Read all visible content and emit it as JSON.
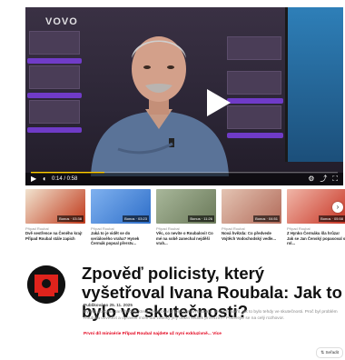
{
  "player": {
    "logo": "VOVO",
    "time": "0:14 / 0:58",
    "progress": 0.24,
    "icons": [
      "play-icon",
      "volume-icon",
      "settings-icon",
      "share-icon",
      "fullscreen-icon"
    ]
  },
  "carousel": [
    {
      "tag": "Případ Roubal",
      "title": "Dvě sestřence na Čeného kraj! Případ Roubal stále zapich",
      "duration": "Bonus · 03:38",
      "colors": [
        "#c0391b",
        "#f1e3cf"
      ]
    },
    {
      "tag": "Případ Roubal",
      "title": "Jaká to je vidět se do seriálového vraha? Hynek Čermák popsal přerstv...",
      "duration": "Bonus · 03:23",
      "colors": [
        "#2f6fc9",
        "#7fb1ef"
      ]
    },
    {
      "tag": "Případ Roubal",
      "title": "Věc, co nevíte o Roubalovi! Co mé na sobě zanechal nejděší vrah...",
      "duration": "Bonus · 11:26",
      "colors": [
        "#6b7a5a",
        "#a8b79a"
      ]
    },
    {
      "tag": "Případ Roubal",
      "title": "Nová hvězda: Co předvede Vojtěch Vodochodský vedle...",
      "duration": "Bonus · 04:51",
      "colors": [
        "#b26b5a",
        "#e4c4b3"
      ]
    },
    {
      "tag": "Případ Roubal",
      "title": "Z Hynko Čermáku šla hrůza! Jak se Jan Čenský popasoval s rol...",
      "duration": "Bonus · 05:58",
      "colors": [
        "#c83424",
        "#f0b6a8"
      ]
    }
  ],
  "carousel_next": "›",
  "article": {
    "title": "Zpověď policisty, který vyšetřoval Ivana Roubala: Jak to bylo ve skutečnosti?",
    "meta": "Publikováno 25. 11. 2025",
    "body": "Bývalý policista Jan Štoček, který vyšetřoval případ Ivana Roubala, se nám svěřil, jak to bylo tehdy ve skutečnosti. Proč byl problém Roubala usvědčit a opravdu mohl dát zabitky jiný otázit sedlák provozím? Podívejte se na celý rozhovor.",
    "promo": "První díl minisérie Případ Roubal najdete už nyní exkluzivně...",
    "promo_more": "Více"
  },
  "sort_label": "Seřadit"
}
